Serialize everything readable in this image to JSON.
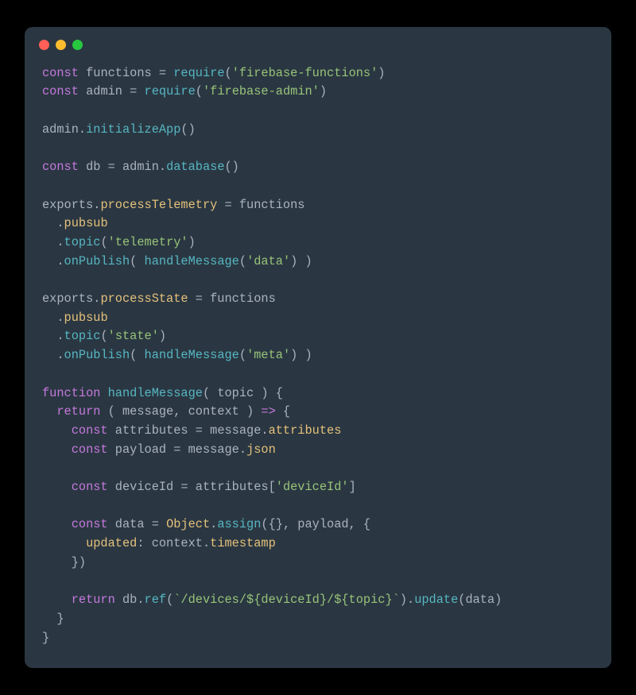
{
  "window": {
    "dots": [
      "red",
      "yellow",
      "green"
    ]
  },
  "code": {
    "lines": [
      [
        {
          "c": "kw",
          "t": "const"
        },
        {
          "c": "pl",
          "t": " functions "
        },
        {
          "c": "pl",
          "t": "= "
        },
        {
          "c": "fn",
          "t": "require"
        },
        {
          "c": "pl",
          "t": "("
        },
        {
          "c": "str",
          "t": "'firebase-functions'"
        },
        {
          "c": "pl",
          "t": ")"
        }
      ],
      [
        {
          "c": "kw",
          "t": "const"
        },
        {
          "c": "pl",
          "t": " admin "
        },
        {
          "c": "pl",
          "t": "= "
        },
        {
          "c": "fn",
          "t": "require"
        },
        {
          "c": "pl",
          "t": "("
        },
        {
          "c": "str",
          "t": "'firebase-admin'"
        },
        {
          "c": "pl",
          "t": ")"
        }
      ],
      [],
      [
        {
          "c": "pl",
          "t": "admin."
        },
        {
          "c": "fn",
          "t": "initializeApp"
        },
        {
          "c": "pl",
          "t": "()"
        }
      ],
      [],
      [
        {
          "c": "kw",
          "t": "const"
        },
        {
          "c": "pl",
          "t": " db "
        },
        {
          "c": "pl",
          "t": "= admin."
        },
        {
          "c": "fn",
          "t": "database"
        },
        {
          "c": "pl",
          "t": "()"
        }
      ],
      [],
      [
        {
          "c": "pl",
          "t": "exports."
        },
        {
          "c": "id",
          "t": "processTelemetry"
        },
        {
          "c": "pl",
          "t": " = functions"
        }
      ],
      [
        {
          "c": "pl",
          "t": "  ."
        },
        {
          "c": "id",
          "t": "pubsub"
        }
      ],
      [
        {
          "c": "pl",
          "t": "  ."
        },
        {
          "c": "fn",
          "t": "topic"
        },
        {
          "c": "pl",
          "t": "("
        },
        {
          "c": "str",
          "t": "'telemetry'"
        },
        {
          "c": "pl",
          "t": ")"
        }
      ],
      [
        {
          "c": "pl",
          "t": "  ."
        },
        {
          "c": "fn",
          "t": "onPublish"
        },
        {
          "c": "pl",
          "t": "( "
        },
        {
          "c": "fn",
          "t": "handleMessage"
        },
        {
          "c": "pl",
          "t": "("
        },
        {
          "c": "str",
          "t": "'data'"
        },
        {
          "c": "pl",
          "t": ") )"
        }
      ],
      [],
      [
        {
          "c": "pl",
          "t": "exports."
        },
        {
          "c": "id",
          "t": "processState"
        },
        {
          "c": "pl",
          "t": " = functions"
        }
      ],
      [
        {
          "c": "pl",
          "t": "  ."
        },
        {
          "c": "id",
          "t": "pubsub"
        }
      ],
      [
        {
          "c": "pl",
          "t": "  ."
        },
        {
          "c": "fn",
          "t": "topic"
        },
        {
          "c": "pl",
          "t": "("
        },
        {
          "c": "str",
          "t": "'state'"
        },
        {
          "c": "pl",
          "t": ")"
        }
      ],
      [
        {
          "c": "pl",
          "t": "  ."
        },
        {
          "c": "fn",
          "t": "onPublish"
        },
        {
          "c": "pl",
          "t": "( "
        },
        {
          "c": "fn",
          "t": "handleMessage"
        },
        {
          "c": "pl",
          "t": "("
        },
        {
          "c": "str",
          "t": "'meta'"
        },
        {
          "c": "pl",
          "t": ") )"
        }
      ],
      [],
      [
        {
          "c": "kw",
          "t": "function"
        },
        {
          "c": "pl",
          "t": " "
        },
        {
          "c": "fn",
          "t": "handleMessage"
        },
        {
          "c": "pl",
          "t": "( "
        },
        {
          "c": "pl",
          "t": "topic"
        },
        {
          "c": "pl",
          "t": " ) {"
        }
      ],
      [
        {
          "c": "pl",
          "t": "  "
        },
        {
          "c": "kw",
          "t": "return"
        },
        {
          "c": "pl",
          "t": " ( message, context ) "
        },
        {
          "c": "kw",
          "t": "=>"
        },
        {
          "c": "pl",
          "t": " {"
        }
      ],
      [
        {
          "c": "pl",
          "t": "    "
        },
        {
          "c": "kw",
          "t": "const"
        },
        {
          "c": "pl",
          "t": " attributes "
        },
        {
          "c": "pl",
          "t": "= message."
        },
        {
          "c": "id",
          "t": "attributes"
        }
      ],
      [
        {
          "c": "pl",
          "t": "    "
        },
        {
          "c": "kw",
          "t": "const"
        },
        {
          "c": "pl",
          "t": " payload "
        },
        {
          "c": "pl",
          "t": "= message."
        },
        {
          "c": "id",
          "t": "json"
        }
      ],
      [],
      [
        {
          "c": "pl",
          "t": "    "
        },
        {
          "c": "kw",
          "t": "const"
        },
        {
          "c": "pl",
          "t": " deviceId "
        },
        {
          "c": "pl",
          "t": "= attributes["
        },
        {
          "c": "str",
          "t": "'deviceId'"
        },
        {
          "c": "pl",
          "t": "]"
        }
      ],
      [],
      [
        {
          "c": "pl",
          "t": "    "
        },
        {
          "c": "kw",
          "t": "const"
        },
        {
          "c": "pl",
          "t": " data "
        },
        {
          "c": "pl",
          "t": "= "
        },
        {
          "c": "id",
          "t": "Object"
        },
        {
          "c": "pl",
          "t": "."
        },
        {
          "c": "fn",
          "t": "assign"
        },
        {
          "c": "pl",
          "t": "({}, payload, {"
        }
      ],
      [
        {
          "c": "pl",
          "t": "      "
        },
        {
          "c": "id",
          "t": "updated"
        },
        {
          "c": "pl",
          "t": ": context."
        },
        {
          "c": "id",
          "t": "timestamp"
        }
      ],
      [
        {
          "c": "pl",
          "t": "    })"
        }
      ],
      [],
      [
        {
          "c": "pl",
          "t": "    "
        },
        {
          "c": "kw",
          "t": "return"
        },
        {
          "c": "pl",
          "t": " db."
        },
        {
          "c": "fn",
          "t": "ref"
        },
        {
          "c": "pl",
          "t": "("
        },
        {
          "c": "str",
          "t": "`/devices/${deviceId}/${topic}`"
        },
        {
          "c": "pl",
          "t": ")."
        },
        {
          "c": "fn",
          "t": "update"
        },
        {
          "c": "pl",
          "t": "(data)"
        }
      ],
      [
        {
          "c": "pl",
          "t": "  }"
        }
      ],
      [
        {
          "c": "pl",
          "t": "}"
        }
      ]
    ]
  }
}
